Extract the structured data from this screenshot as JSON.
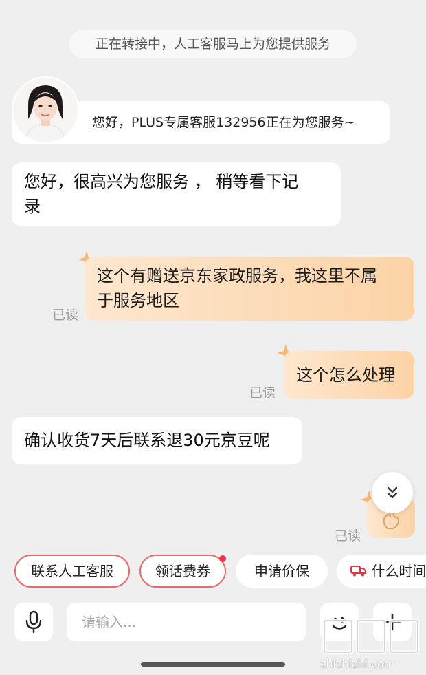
{
  "chat": {
    "system_notice": "正在转接中，人工客服马上为您提供服务",
    "agent_greeting": "您好，PLUS专属客服132956正在为您服务~",
    "messages": [
      {
        "side": "left",
        "text_lines": [
          "您好，很高兴为您服务 ， 稍等看下记",
          "录"
        ]
      },
      {
        "side": "right",
        "text_lines": [
          "这个有赠送京东家政服务，我这里不属",
          "于服务地区"
        ],
        "status": "已读"
      },
      {
        "side": "right",
        "text_lines": [
          "这个怎么处理"
        ],
        "status": "已读"
      },
      {
        "side": "left",
        "text_lines": [
          "确认收货7天后联系退30元京豆呢"
        ]
      },
      {
        "side": "right",
        "text_lines": [
          ""
        ],
        "status": "已读"
      }
    ]
  },
  "quick_replies": [
    {
      "label": "联系人工客服",
      "style": "outlined"
    },
    {
      "label": "领话费券",
      "style": "outlined",
      "badge": true
    },
    {
      "label": "申请价保",
      "style": "plain"
    },
    {
      "label": "什么时间",
      "style": "plain",
      "icon": "truck-icon"
    }
  ],
  "input": {
    "placeholder": "请输入..."
  },
  "icons": {
    "voice": "microphone-icon",
    "emoji": "emoji-icon",
    "more": "plus-icon",
    "scroll": "double-chevron-down-icon"
  },
  "colors": {
    "accent_red": "#e86a6a",
    "badge_red": "#f0334a",
    "bubble_right_start": "#fde7cf",
    "bubble_right_end": "#fcd3a6",
    "background": "#efefef"
  },
  "watermark": {
    "text": "值值值",
    "url": "zhizhizhi.com"
  }
}
